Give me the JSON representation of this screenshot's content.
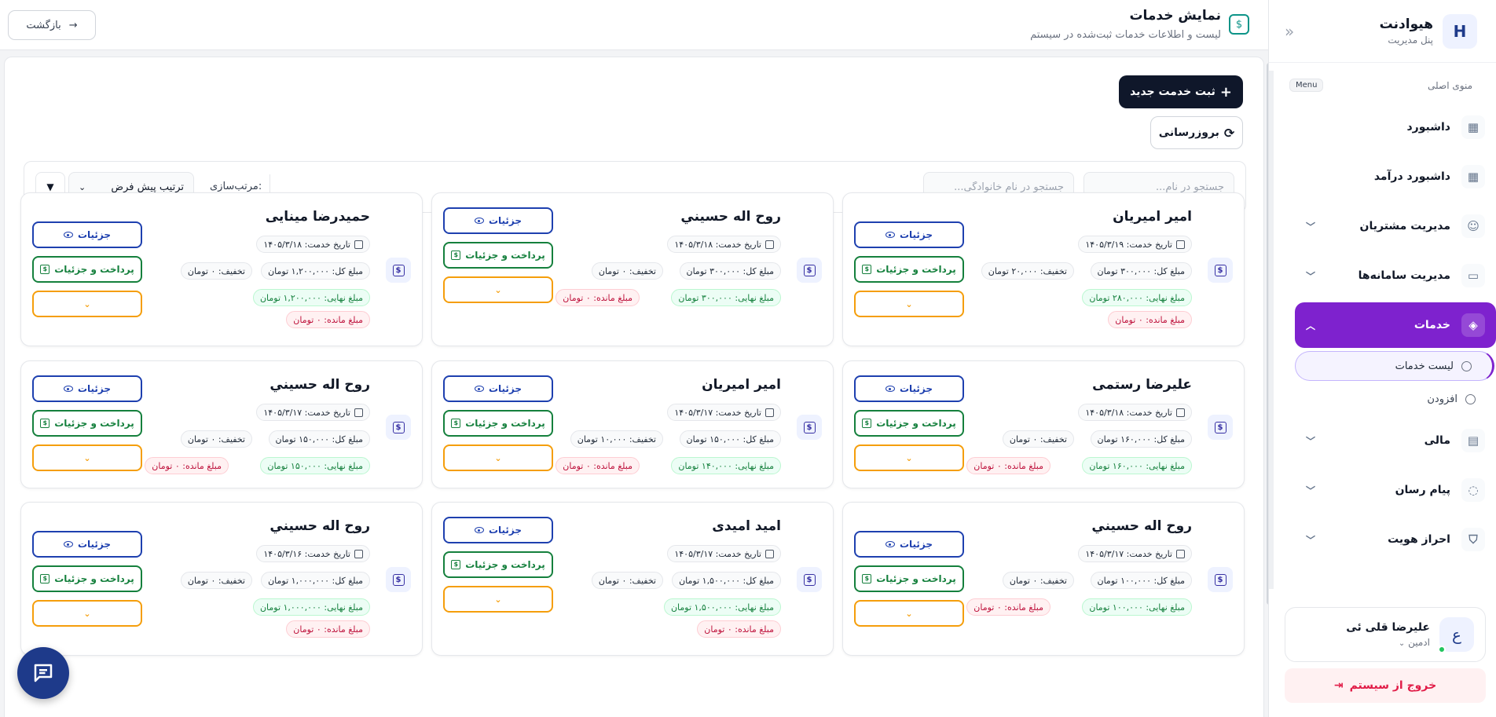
{
  "app": {
    "name": "هیوادنت",
    "subtitle": "پنل مدیریت"
  },
  "sidebar": {
    "menu_title": "منوی اصلی",
    "menu_badge": "Menu",
    "items": [
      {
        "label": "داشبورد",
        "icon": "grid-icon",
        "expandable": false
      },
      {
        "label": "داشبورد درآمد",
        "icon": "grid-icon",
        "expandable": false
      },
      {
        "label": "مدیریت مشتریان",
        "icon": "users-icon",
        "expandable": true
      },
      {
        "label": "مدیریت سامانه‌ها",
        "icon": "window-icon",
        "expandable": true
      },
      {
        "label": "خدمات",
        "icon": "layers-icon",
        "expandable": true,
        "active": true
      },
      {
        "label": "مالی",
        "icon": "document-icon",
        "expandable": true
      },
      {
        "label": "پیام رسان",
        "icon": "chat-icon",
        "expandable": true
      },
      {
        "label": "احراز هویت",
        "icon": "shield-icon",
        "expandable": true
      }
    ],
    "subitems": [
      {
        "label": "لیست خدمات",
        "active": true
      },
      {
        "label": "افزودن",
        "active": false
      }
    ],
    "user": {
      "avatar_letter": "ع",
      "name": "علیرضا قلی ئی",
      "role": "ادمین"
    },
    "logout_label": "خروج از سیستم"
  },
  "header": {
    "title": "نمایش خدمات",
    "subtitle": "لیست و اطلاعات خدمات ثبت‌شده در سیستم",
    "back_label": "بازگشت"
  },
  "toolbar": {
    "new_label": "ثبت خدمت جدید",
    "refresh_label": "بروزرسانی"
  },
  "filters": {
    "search_name_placeholder": "جستجو در نام...",
    "search_family_placeholder": "جستجو در نام خانوادگی...",
    "sort_label": "مرتب‌سازی:",
    "sort_value": "ترتیب پیش فرض",
    "sort_direction": "▼"
  },
  "card_labels": {
    "details": "جزئیات",
    "pay_details": "پرداخت و جزئیات",
    "more": "⌄"
  },
  "cards": [
    {
      "name": "امیر امیریان",
      "date": "تاریخ خدمت: ۱۴۰۵/۳/۱۹",
      "total": "مبلغ کل: ۳۰۰,۰۰۰ تومان",
      "discount": "تخفیف: ۲۰,۰۰۰ تومان",
      "final": "مبلغ نهایی: ۲۸۰,۰۰۰ تومان",
      "remaining": "مبلغ مانده: ۰ تومان"
    },
    {
      "name": "روح اله حسيني",
      "date": "تاریخ خدمت: ۱۴۰۵/۳/۱۸",
      "total": "مبلغ کل: ۳۰۰,۰۰۰ تومان",
      "discount": "تخفیف: ۰ تومان",
      "final": "مبلغ نهایی: ۳۰۰,۰۰۰ تومان",
      "remaining": "مبلغ مانده: ۰ تومان"
    },
    {
      "name": "حمیدرضا مینایی",
      "date": "تاریخ خدمت: ۱۴۰۵/۳/۱۸",
      "total": "مبلغ کل: ۱,۲۰۰,۰۰۰ تومان",
      "discount": "تخفیف: ۰ تومان",
      "final": "مبلغ نهایی: ۱,۲۰۰,۰۰۰ تومان",
      "remaining": "مبلغ مانده: ۰ تومان"
    },
    {
      "name": "علیرضا رستمی",
      "date": "تاریخ خدمت: ۱۴۰۵/۳/۱۸",
      "total": "مبلغ کل: ۱۶۰,۰۰۰ تومان",
      "discount": "تخفیف: ۰ تومان",
      "final": "مبلغ نهایی: ۱۶۰,۰۰۰ تومان",
      "remaining": "مبلغ مانده: ۰ تومان"
    },
    {
      "name": "امیر امیریان",
      "date": "تاریخ خدمت: ۱۴۰۵/۳/۱۷",
      "total": "مبلغ کل: ۱۵۰,۰۰۰ تومان",
      "discount": "تخفیف: ۱۰,۰۰۰ تومان",
      "final": "مبلغ نهایی: ۱۴۰,۰۰۰ تومان",
      "remaining": "مبلغ مانده: ۰ تومان"
    },
    {
      "name": "روح اله حسيني",
      "date": "تاریخ خدمت: ۱۴۰۵/۳/۱۷",
      "total": "مبلغ کل: ۱۵۰,۰۰۰ تومان",
      "discount": "تخفیف: ۰ تومان",
      "final": "مبلغ نهایی: ۱۵۰,۰۰۰ تومان",
      "remaining": "مبلغ مانده: ۰ تومان"
    },
    {
      "name": "روح اله حسيني",
      "date": "تاریخ خدمت: ۱۴۰۵/۳/۱۷",
      "total": "مبلغ کل: ۱۰۰,۰۰۰ تومان",
      "discount": "تخفیف: ۰ تومان",
      "final": "مبلغ نهایی: ۱۰۰,۰۰۰ تومان",
      "remaining": "مبلغ مانده: ۰ تومان"
    },
    {
      "name": "امید امیدی",
      "date": "تاریخ خدمت: ۱۴۰۵/۳/۱۷",
      "total": "مبلغ کل: ۱,۵۰۰,۰۰۰ تومان",
      "discount": "تخفیف: ۰ تومان",
      "final": "مبلغ نهایی: ۱,۵۰۰,۰۰۰ تومان",
      "remaining": "مبلغ مانده: ۰ تومان"
    },
    {
      "name": "روح اله حسيني",
      "date": "تاریخ خدمت: ۱۴۰۵/۳/۱۶",
      "total": "مبلغ کل: ۱,۰۰۰,۰۰۰ تومان",
      "discount": "تخفیف: ۰ تومان",
      "final": "مبلغ نهایی: ۱,۰۰۰,۰۰۰ تومان",
      "remaining": "مبلغ مانده: ۰ تومان"
    }
  ]
}
